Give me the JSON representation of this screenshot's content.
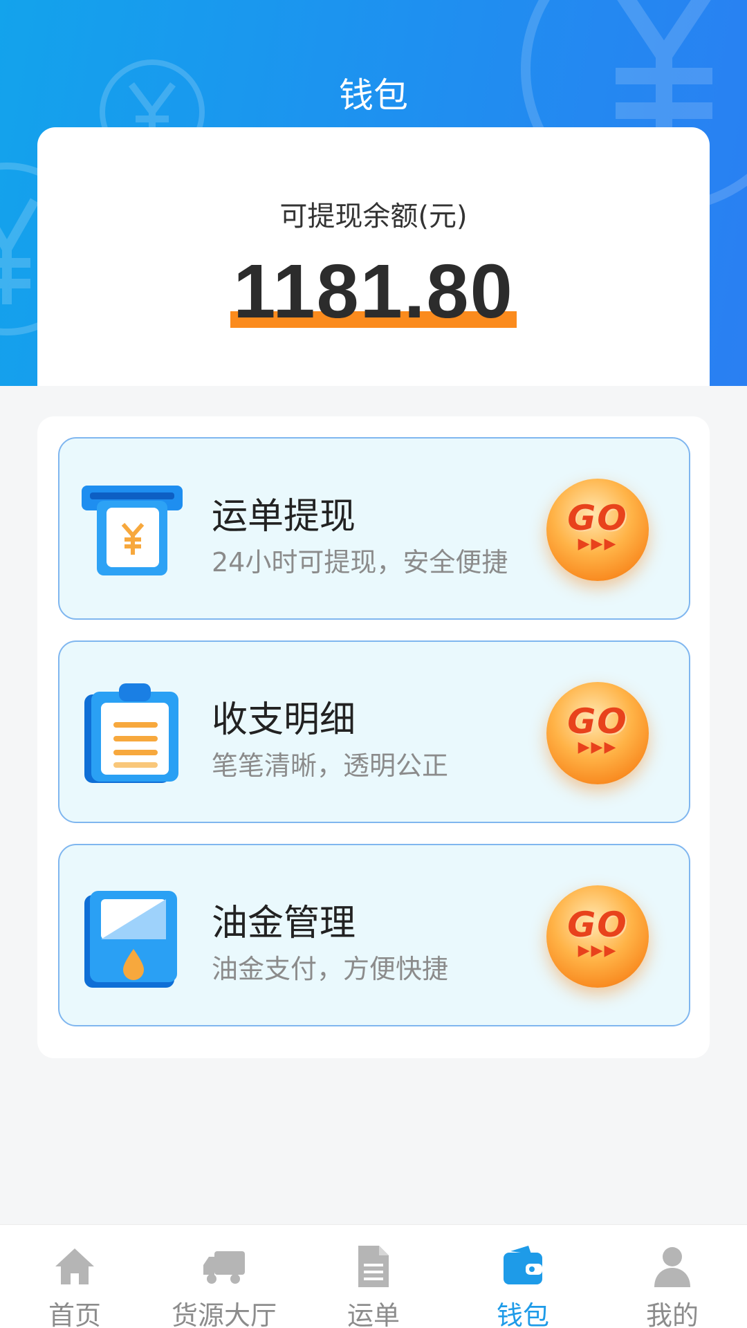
{
  "header": {
    "title": "钱包"
  },
  "balance": {
    "label": "可提现余额(元)",
    "amount": "1181.80"
  },
  "menu": [
    {
      "title": "运单提现",
      "subtitle": "24小时可提现，安全便捷",
      "icon": "withdraw-icon",
      "action": "GO"
    },
    {
      "title": "收支明细",
      "subtitle": "笔笔清晰，透明公正",
      "icon": "clipboard-icon",
      "action": "GO"
    },
    {
      "title": "油金管理",
      "subtitle": "油金支付，方便快捷",
      "icon": "fuel-icon",
      "action": "GO"
    }
  ],
  "nav": {
    "active_index": 3,
    "items": [
      {
        "label": "首页",
        "icon": "home-icon"
      },
      {
        "label": "货源大厅",
        "icon": "truck-icon"
      },
      {
        "label": "运单",
        "icon": "document-icon"
      },
      {
        "label": "钱包",
        "icon": "wallet-icon"
      },
      {
        "label": "我的",
        "icon": "user-icon"
      }
    ]
  },
  "colors": {
    "header_blue": "#1f8ff0",
    "accent_orange": "#fb8b1d",
    "active_nav": "#1e9be8",
    "card_bg": "#eaf9fd",
    "card_border": "#7fb6ef"
  }
}
